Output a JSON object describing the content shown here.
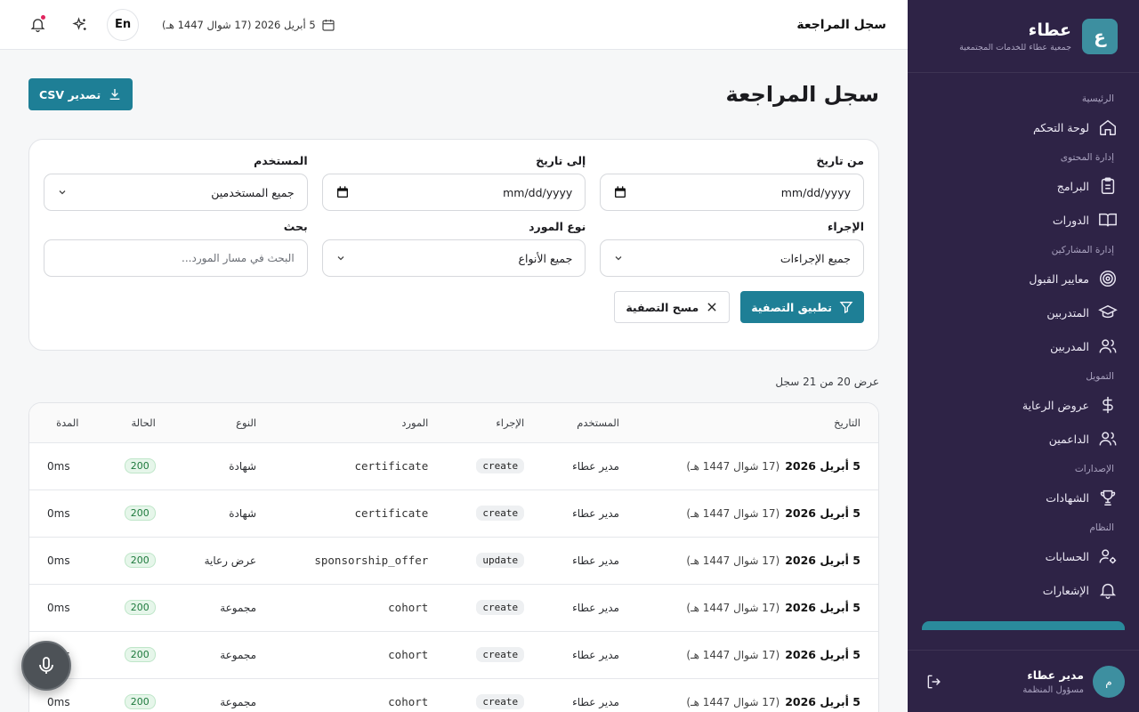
{
  "sidebar": {
    "brand_logo": "ع",
    "brand_name": "عطاء",
    "brand_sub": "جمعية عطاء للخدمات المجتمعية",
    "groups": [
      {
        "title": "الرئيسية",
        "items": [
          {
            "label": "لوحة التحكم",
            "icon": "home-icon"
          }
        ]
      },
      {
        "title": "إدارة المحتوى",
        "items": [
          {
            "label": "البرامج",
            "icon": "clipboard-icon"
          },
          {
            "label": "الدورات",
            "icon": "book-icon"
          }
        ]
      },
      {
        "title": "إدارة المشاركين",
        "items": [
          {
            "label": "معايير القبول",
            "icon": "target-icon"
          },
          {
            "label": "المتدربين",
            "icon": "graduation-cap-icon"
          },
          {
            "label": "المدربين",
            "icon": "users-icon"
          }
        ]
      },
      {
        "title": "التمويل",
        "items": [
          {
            "label": "عروض الرعاية",
            "icon": "dollar-icon"
          },
          {
            "label": "الداعمين",
            "icon": "users-icon"
          }
        ]
      },
      {
        "title": "الإصدارات",
        "items": [
          {
            "label": "الشهادات",
            "icon": "trophy-icon"
          }
        ]
      },
      {
        "title": "النظام",
        "items": [
          {
            "label": "الحسابات",
            "icon": "user-cog-icon"
          },
          {
            "label": "الإشعارات",
            "icon": "bell-icon"
          }
        ]
      }
    ],
    "user": {
      "initial": "م",
      "name": "مدير عطاء",
      "role": "مسؤول المنظمة"
    }
  },
  "topbar": {
    "title": "سجل المراجعة",
    "date": "5 أبريل 2026 (17 شوال 1447 هـ)",
    "lang": "En"
  },
  "page": {
    "title": "سجل المراجعة",
    "export_label": "تصدير CSV"
  },
  "filters": {
    "from_date_label": "من تاريخ",
    "from_date_value": "mm/dd/yyyy",
    "to_date_label": "إلى تاريخ",
    "to_date_value": "mm/dd/yyyy",
    "user_label": "المستخدم",
    "user_value": "جميع المستخدمين",
    "action_label": "الإجراء",
    "action_value": "جميع الإجراءات",
    "resource_label": "نوع المورد",
    "resource_value": "جميع الأنواع",
    "search_label": "بحث",
    "search_placeholder": "البحث في مسار المورد...",
    "apply_label": "تطبيق التصفية",
    "clear_label": "مسح التصفية"
  },
  "results": {
    "count_text": "عرض 20 من 21 سجل"
  },
  "table": {
    "columns": [
      "التاريخ",
      "المستخدم",
      "الإجراء",
      "المورد",
      "النوع",
      "الحالة",
      "المدة"
    ],
    "rows": [
      {
        "date": "5 أبريل 2026",
        "hijri": "(17 شوال 1447 هـ)",
        "user": "مدير عطاء",
        "action": "create",
        "resource": "certificate",
        "type": "شهادة",
        "status": "200",
        "duration": "0ms"
      },
      {
        "date": "5 أبريل 2026",
        "hijri": "(17 شوال 1447 هـ)",
        "user": "مدير عطاء",
        "action": "create",
        "resource": "certificate",
        "type": "شهادة",
        "status": "200",
        "duration": "0ms"
      },
      {
        "date": "5 أبريل 2026",
        "hijri": "(17 شوال 1447 هـ)",
        "user": "مدير عطاء",
        "action": "update",
        "resource": "sponsorship_offer",
        "type": "عرض رعاية",
        "status": "200",
        "duration": "0ms"
      },
      {
        "date": "5 أبريل 2026",
        "hijri": "(17 شوال 1447 هـ)",
        "user": "مدير عطاء",
        "action": "create",
        "resource": "cohort",
        "type": "مجموعة",
        "status": "200",
        "duration": "0ms"
      },
      {
        "date": "5 أبريل 2026",
        "hijri": "(17 شوال 1447 هـ)",
        "user": "مدير عطاء",
        "action": "create",
        "resource": "cohort",
        "type": "مجموعة",
        "status": "200",
        "duration": "0ms"
      },
      {
        "date": "5 أبريل 2026",
        "hijri": "(17 شوال 1447 هـ)",
        "user": "مدير عطاء",
        "action": "create",
        "resource": "cohort",
        "type": "مجموعة",
        "status": "200",
        "duration": "0ms"
      }
    ]
  },
  "colors": {
    "sidebar_bg": "#2e2346",
    "accent": "#1e7f96",
    "status_ok": "#1e7a3d"
  }
}
